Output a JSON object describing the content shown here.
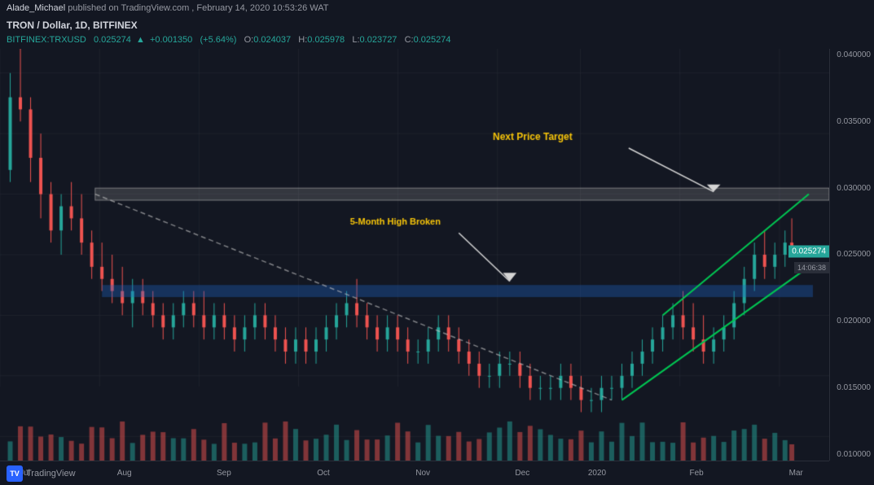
{
  "header": {
    "author": "Alade_Michael",
    "platform": "TradingView.com",
    "date": "February 14, 2020 10:53:26 WAT",
    "full_text": "Alade_Michael published on TradingView.com, February 14, 2020 10:53:26 WAT"
  },
  "chart_info": {
    "title": "TRON / Dollar, 1D, BITFINEX",
    "symbol": "BITFINEX:TRXUSD",
    "timeframe": "1D",
    "indicator": "Vol (20)",
    "current_price": "0.025274",
    "change": "+0.001350",
    "change_pct": "+5.64%",
    "open": "0.024037",
    "high": "0.025978",
    "low": "0.023727",
    "close": "0.025274"
  },
  "annotations": {
    "next_price_target": "Next Price Target",
    "five_month_high": "5-Month High Broken"
  },
  "price_levels": {
    "current": "0.025274",
    "time": "14:06:38",
    "p040000": "0.040000",
    "p035000": "0.035000",
    "p030000": "0.030000",
    "p025000": "0.025000",
    "p020000": "0.020000",
    "p015000": "0.015000",
    "p010000": "0.010000"
  },
  "x_labels": [
    "Jul",
    "Aug",
    "Sep",
    "Oct",
    "Nov",
    "Dec",
    "2020",
    "Feb",
    "Mar"
  ],
  "tradingview": {
    "logo_text": "TradingView"
  }
}
